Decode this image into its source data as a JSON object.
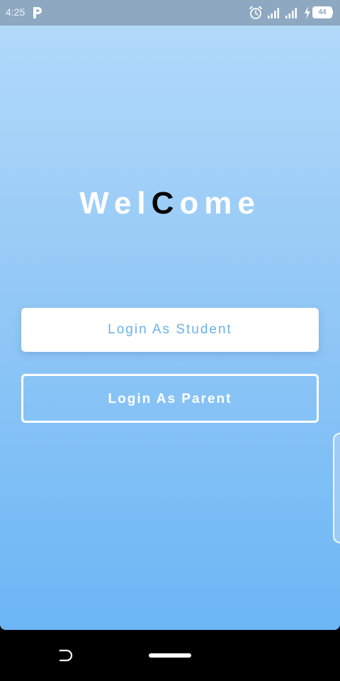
{
  "status_bar": {
    "time": "4:25",
    "battery_level": "44",
    "icons": [
      "p-icon",
      "alarm-icon",
      "signal-icon",
      "signal-icon",
      "charging-bolt-icon",
      "battery-icon"
    ]
  },
  "welcome": {
    "part1": "Wel",
    "accent": "C",
    "part2": "ome"
  },
  "buttons": {
    "student_label": "Login As Student",
    "parent_label": "Login As Parent"
  },
  "colors": {
    "gradient_top": "#b4dbfb",
    "gradient_bottom": "#6cb6f5",
    "status_bar": "#8ea8c2",
    "student_text": "#6ab2ea",
    "accent_letter": "#050505"
  }
}
